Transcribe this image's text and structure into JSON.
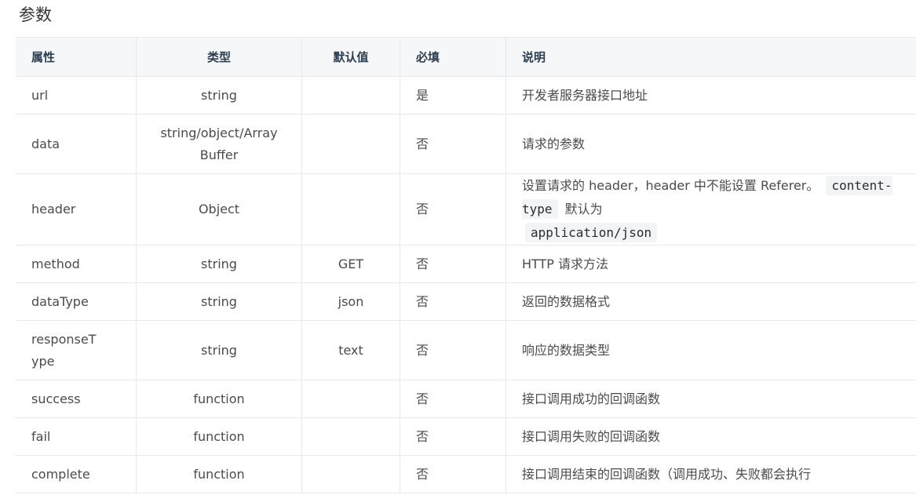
{
  "section_title": "参数",
  "table": {
    "headers": {
      "attr": "属性",
      "type": "类型",
      "default": "默认值",
      "required": "必填",
      "desc": "说明"
    },
    "rows": [
      {
        "attr": "url",
        "type": "string",
        "default": "",
        "required": "是",
        "desc": "开发者服务器接口地址"
      },
      {
        "attr": "data",
        "type": "string/object/ArrayBuffer",
        "default": "",
        "required": "否",
        "desc": "请求的参数"
      },
      {
        "attr": "header",
        "type": "Object",
        "default": "",
        "required": "否",
        "desc_parts": {
          "pre": "设置请求的 header，header 中不能设置 Referer。",
          "code1": "content-type",
          "mid": "默认为",
          "code2": "application/json"
        }
      },
      {
        "attr": "method",
        "type": "string",
        "default": "GET",
        "required": "否",
        "desc": "HTTP 请求方法"
      },
      {
        "attr": "dataType",
        "type": "string",
        "default": "json",
        "required": "否",
        "desc": "返回的数据格式"
      },
      {
        "attr": "responseType",
        "type": "string",
        "default": "text",
        "required": "否",
        "desc": "响应的数据类型"
      },
      {
        "attr": "success",
        "type": "function",
        "default": "",
        "required": "否",
        "desc": "接口调用成功的回调函数"
      },
      {
        "attr": "fail",
        "type": "function",
        "default": "",
        "required": "否",
        "desc": "接口调用失败的回调函数"
      },
      {
        "attr": "complete",
        "type": "function",
        "default": "",
        "required": "否",
        "desc": "接口调用结束的回调函数（调用成功、失败都会执行"
      }
    ]
  },
  "colors": {
    "header_bg": "#f6f7f8",
    "border": "#e6e8eb",
    "code_bg": "#f3f4f5"
  }
}
